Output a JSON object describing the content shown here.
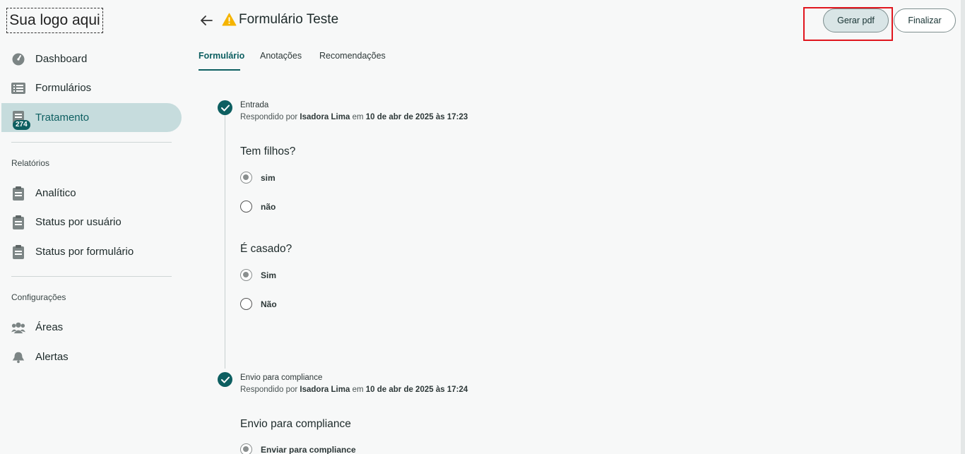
{
  "sidebar": {
    "logo": "Sua logo aqui",
    "items": [
      {
        "label": "Dashboard",
        "icon": "dashboard-icon"
      },
      {
        "label": "Formulários",
        "icon": "list-icon"
      },
      {
        "label": "Tratamento",
        "icon": "treatment-icon",
        "badge": "274",
        "active": true
      }
    ],
    "reports_label": "Relatórios",
    "reports": [
      {
        "label": "Analítico",
        "icon": "clipboard-icon"
      },
      {
        "label": "Status por usuário",
        "icon": "clipboard-icon"
      },
      {
        "label": "Status por formulário",
        "icon": "clipboard-icon"
      }
    ],
    "config_label": "Configurações",
    "config": [
      {
        "label": "Áreas",
        "icon": "people-icon"
      },
      {
        "label": "Alertas",
        "icon": "bell-icon"
      }
    ]
  },
  "header": {
    "title": "Formulário Teste",
    "pdf_button": "Gerar pdf",
    "finish_button": "Finalizar"
  },
  "tabs": [
    {
      "label": "Formulário",
      "active": true
    },
    {
      "label": "Anotações"
    },
    {
      "label": "Recomendações"
    }
  ],
  "steps": [
    {
      "title": "Entrada",
      "meta_prefix": "Respondido por",
      "user": "Isadora Lima",
      "meta_mid": "em",
      "date": "10 de abr de 2025 às 17:23",
      "questions": [
        {
          "question": "Tem filhos?",
          "options": [
            {
              "label": "sim",
              "checked": true
            },
            {
              "label": "não",
              "checked": false
            }
          ]
        },
        {
          "question": "É casado?",
          "options": [
            {
              "label": "Sim",
              "checked": true
            },
            {
              "label": "Não",
              "checked": false
            }
          ]
        }
      ]
    },
    {
      "title": "Envio para compliance",
      "meta_prefix": "Respondido por",
      "user": "Isadora Lima",
      "meta_mid": "em",
      "date": "10 de abr de 2025 às 17:24",
      "questions": [
        {
          "question": "Envio para compliance",
          "options": [
            {
              "label": "Enviar para compliance",
              "checked": true
            }
          ]
        }
      ]
    }
  ],
  "colors": {
    "primary": "#0d5f61",
    "active_bg": "#c6dcdd",
    "highlight": "#e0161e",
    "warning": "#f5b400"
  }
}
